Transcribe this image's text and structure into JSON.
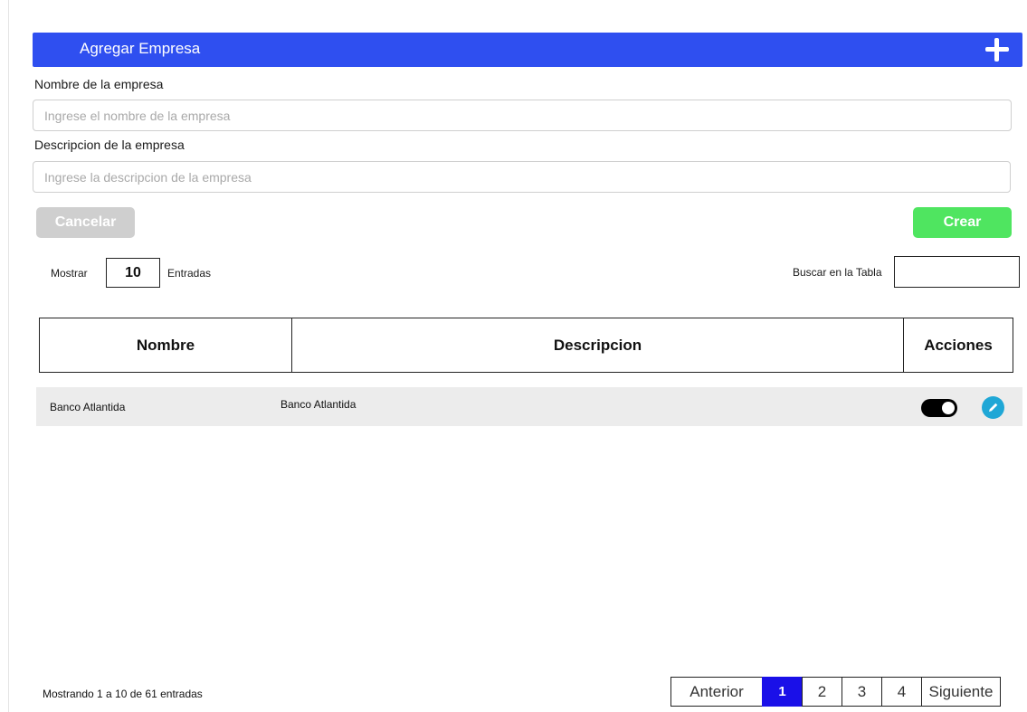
{
  "header": {
    "title": "Agregar Empresa",
    "add_icon": "plus-icon",
    "color": "#2f4ff0"
  },
  "form": {
    "name_label": "Nombre de la empresa",
    "name_placeholder": "Ingrese el nombre de la empresa",
    "desc_label": "Descripcion de la empresa",
    "desc_placeholder": "Ingrese la descripcion de la empresa",
    "cancel_label": "Cancelar",
    "create_label": "Crear",
    "create_color": "#4fe560"
  },
  "controls": {
    "show_label": "Mostrar",
    "entries_value": "10",
    "entries_label": "Entradas",
    "search_label": "Buscar en la Tabla"
  },
  "table": {
    "columns": [
      "Nombre",
      "Descripcion",
      "Acciones"
    ],
    "rows": [
      {
        "nombre": "Banco Atlantida",
        "descripcion": "Banco Atlantida",
        "active": true
      }
    ]
  },
  "footer": {
    "info": "Mostrando 1 a 10 de 61 entradas",
    "pagination": {
      "prev": "Anterior",
      "pages": [
        "1",
        "2",
        "3",
        "4"
      ],
      "current": "1",
      "next": "Siguiente"
    }
  }
}
